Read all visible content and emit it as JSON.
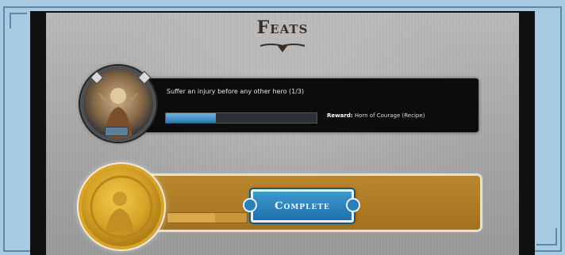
{
  "feats": {
    "title": "Feats",
    "items": [
      {
        "description": "Suffer an injury before any other hero (1/3)",
        "progress": 0.33,
        "reward_label": "Reward:",
        "reward_value": "Horn of Courage (Recipe)"
      },
      {
        "progress": 0.6,
        "status_label": "Complete"
      }
    ]
  },
  "colors": {
    "frame": "#a9cbe2",
    "progress_fill": "#2e78b0",
    "completed_bar": "#b8872f",
    "complete_button": "#2a82bd"
  },
  "icons": {
    "feat1_portrait": "hero-portrait-icon",
    "feat2_medal": "gold-medal-icon",
    "title_ornament": "ornament-icon"
  }
}
